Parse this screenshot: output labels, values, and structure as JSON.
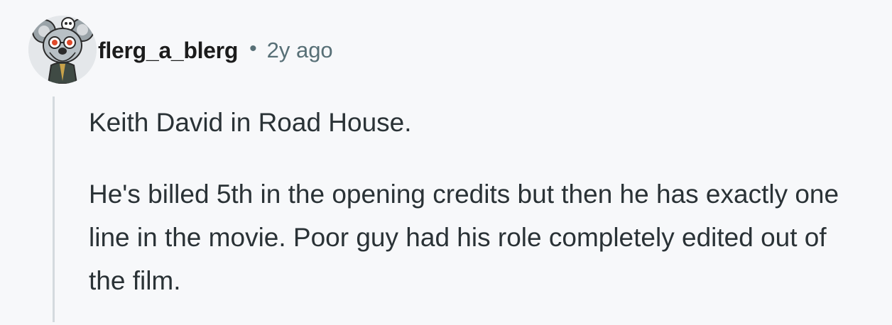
{
  "comment": {
    "author": "flerg_a_blerg",
    "separator": "•",
    "timestamp": "2y ago",
    "paragraphs": [
      "Keith David in Road House.",
      "He's billed 5th in the opening credits but then he has exactly one line in the movie. Poor guy had his role completely edited out of the film."
    ],
    "avatar_icon": "koala-snoovatar-icon"
  },
  "colors": {
    "background": "#f7f8fa",
    "author": "#1c1c1c",
    "meta": "#576f76",
    "body_text": "#2a3236",
    "thread_line": "#d4dade"
  }
}
